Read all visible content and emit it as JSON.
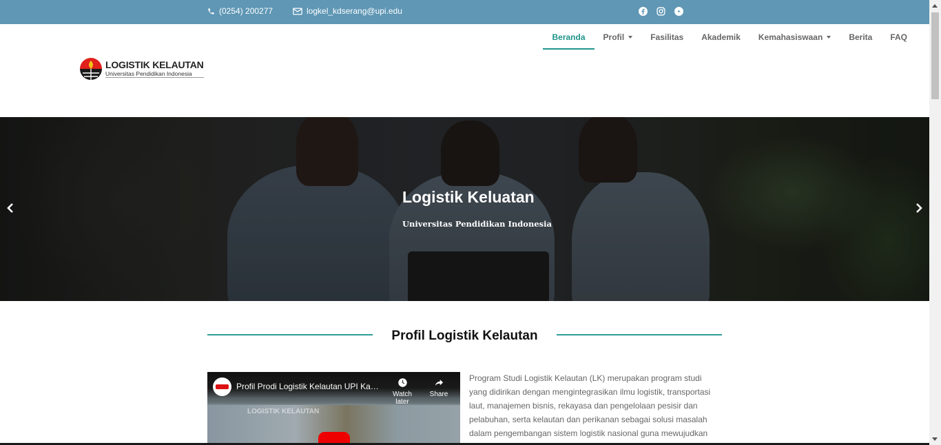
{
  "topbar": {
    "phone": "(0254) 200277",
    "email": "logkel_kdserang@upi.edu",
    "social_icons": [
      "facebook-icon",
      "instagram-icon",
      "youtube-icon"
    ],
    "background": "#5f97b5"
  },
  "logo": {
    "title": "LOGISTIK KELAUTAN",
    "subtitle": "Universitas Pendidikan Indonesia"
  },
  "nav": {
    "items": [
      {
        "label": "Beranda",
        "active": true,
        "dropdown": false
      },
      {
        "label": "Profil",
        "active": false,
        "dropdown": true
      },
      {
        "label": "Fasilitas",
        "active": false,
        "dropdown": false
      },
      {
        "label": "Akademik",
        "active": false,
        "dropdown": false
      },
      {
        "label": "Kemahasiswaan",
        "active": false,
        "dropdown": true
      },
      {
        "label": "Berita",
        "active": false,
        "dropdown": false
      },
      {
        "label": "FAQ",
        "active": false,
        "dropdown": false
      }
    ],
    "accent_color": "#1f958b"
  },
  "hero": {
    "title": "Logistik Keluatan",
    "subtitle": "Universitas Pendidikan Indonesia",
    "prev_icon": "chevron-left-icon",
    "next_icon": "chevron-right-icon"
  },
  "profile_section": {
    "heading": "Profil Logistik Kelautan",
    "line_color": "#2c9c98",
    "video": {
      "title": "Profil Prodi Logistik Kelautan UPI Kampus Serang",
      "watch_later": "Watch later",
      "share": "Share",
      "watermark": "LOGISTIK KELAUTAN"
    },
    "text": "Program Studi Logistik Kelautan (LK) merupakan program studi yang didirikan dengan mengintegrasikan ilmu logistik, transportasi laut, manajemen bisnis, rekayasa dan pengelolaan pesisir dan pelabuhan, serta kelautan dan perikanan sebagai solusi masalah dalam pengembangan sistem logistik nasional guna mewujudkan Indonesia"
  }
}
